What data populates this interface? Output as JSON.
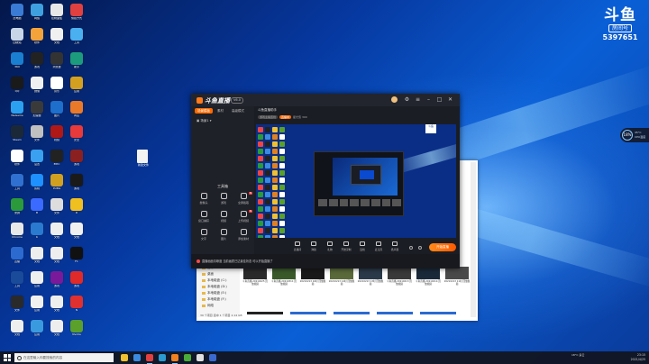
{
  "watermark": {
    "logo": "斗鱼",
    "sub": "房间号",
    "room_number": "5397651"
  },
  "cpu_widget": {
    "value": "18%",
    "line1": "45°C",
    "line2": "CPU温度"
  },
  "desktop": {
    "icons": [
      {
        "label": "此电脑",
        "color": "#3a7bd5"
      },
      {
        "label": "网络",
        "color": "#3fa0e0"
      },
      {
        "label": "控制面板",
        "color": "#e7e7e7"
      },
      {
        "label": "快捷方式",
        "color": "#e04040"
      },
      {
        "label": "回收站",
        "color": "#c8d6e8"
      },
      {
        "label": "软件",
        "color": "#f3a33a"
      },
      {
        "label": "文档",
        "color": "#f0f0f0"
      },
      {
        "label": "工具",
        "color": "#4ab0f0"
      },
      {
        "label": "360",
        "color": "#1a7fd0"
      },
      {
        "label": "游戏",
        "color": "#222"
      },
      {
        "label": "浏览器",
        "color": "#333"
      },
      {
        "label": "助手",
        "color": "#1c9c7c"
      },
      {
        "label": "QQ",
        "color": "#1a1a1a"
      },
      {
        "label": "微信",
        "color": "#f0f0f0"
      },
      {
        "label": "音乐",
        "color": "#ffffff"
      },
      {
        "label": "应用",
        "color": "#d4a020"
      },
      {
        "label": "WeGame",
        "color": "#2ca0f0"
      },
      {
        "label": "加速器",
        "color": "#3a3a3a"
      },
      {
        "label": "图片",
        "color": "#1e6ecc"
      },
      {
        "label": "商店",
        "color": "#ea7a2a"
      },
      {
        "label": "Steam",
        "color": "#1b2838"
      },
      {
        "label": "文件",
        "color": "#c0c0c0"
      },
      {
        "label": "视频",
        "color": "#b01818"
      },
      {
        "label": "安全",
        "color": "#e83a3a"
      },
      {
        "label": "软件",
        "color": "#fff"
      },
      {
        "label": "设置",
        "color": "#3aa0f0"
      },
      {
        "label": "EPIC",
        "color": "#222"
      },
      {
        "label": "游戏",
        "color": "#8a2020"
      },
      {
        "label": "工具",
        "color": "#3070d0"
      },
      {
        "label": "剪辑",
        "color": "#1e90ff"
      },
      {
        "label": "PUBG",
        "color": "#d0a020"
      },
      {
        "label": "游戏",
        "color": "#1a1a1a"
      },
      {
        "label": "录屏",
        "color": "#2a9a3a"
      },
      {
        "label": "B",
        "color": "#3a6aff"
      },
      {
        "label": "文件",
        "color": "#ddd"
      },
      {
        "label": "D",
        "color": "#f0c020"
      },
      {
        "label": "Chrome",
        "color": "#e8e8e8"
      },
      {
        "label": "K",
        "color": "#2a7ad0"
      },
      {
        "label": "文档",
        "color": "#eee"
      },
      {
        "label": "文档",
        "color": "#f0f0f0"
      },
      {
        "label": "直播",
        "color": "#2c6ad0"
      },
      {
        "label": "文档",
        "color": "#eee"
      },
      {
        "label": "文档",
        "color": "#eee"
      },
      {
        "label": "F1",
        "color": "#111"
      },
      {
        "label": "工具",
        "color": "#1a4a9a"
      },
      {
        "label": "应用",
        "color": "#eee"
      },
      {
        "label": "游戏",
        "color": "#7a1a9a"
      },
      {
        "label": "游戏",
        "color": "#e02a2a"
      },
      {
        "label": "文件",
        "color": "#2a2a2a"
      },
      {
        "label": "应用",
        "color": "#f0f0f0"
      },
      {
        "label": "文档",
        "color": "#eee"
      },
      {
        "label": "N",
        "color": "#e03030"
      },
      {
        "label": "文档",
        "color": "#eee"
      },
      {
        "label": "应用",
        "color": "#3a9ae0"
      },
      {
        "label": "文档",
        "color": "#eee"
      },
      {
        "label": "Nvidia",
        "color": "#5aa02a"
      }
    ],
    "stray_file": "新建文件"
  },
  "stream_app": {
    "brand": "斗鱼直播",
    "version": "V6.0",
    "tabs": [
      "场景模板",
      "素材",
      "高级模式"
    ],
    "scene_label": "场景1",
    "tools_title": "工具箱",
    "tools": [
      {
        "label": "摄像头",
        "new": false
      },
      {
        "label": "游戏",
        "new": false
      },
      {
        "label": "全屏截取",
        "new": true
      },
      {
        "label": "窗口捕获",
        "new": false
      },
      {
        "label": "视频",
        "new": false
      },
      {
        "label": "上传视频",
        "new": true
      },
      {
        "label": "文字",
        "new": false
      },
      {
        "label": "图片",
        "new": false
      },
      {
        "label": "添加素材",
        "new": false
      }
    ],
    "header_title": "斗鱼直播助手",
    "pills": [
      "游戏主播连线",
      "直播中"
    ],
    "header_meta": "星光值 300",
    "preview_badge": "斗鱼",
    "controls": [
      "直播间",
      "弹幕",
      "礼物",
      "开始录制",
      "连线",
      "麦克风",
      "扬声器"
    ],
    "start_label": "开始直播",
    "notice": "直播画面清晰度 当前画质已达最佳状态 可以开始直播了"
  },
  "explorer": {
    "nav": [
      "音乐",
      "桌面",
      "本地磁盘 (C:)",
      "本地磁盘 (D:)",
      "本地磁盘 (E:)",
      "本地磁盘 (F:)",
      "网络"
    ],
    "thumbs": [
      {
        "caption": "斗鱼直播 20210225 回放视频"
      },
      {
        "caption": "斗鱼直播 20210311 回放视频"
      },
      {
        "caption": "20210213 16时 回放视频"
      },
      {
        "caption": "20210213 14时 回放视频"
      },
      {
        "caption": "20210213 13时 回放视频"
      },
      {
        "caption": "斗鱼直播 20210213 回放视频"
      },
      {
        "caption": "斗鱼直播 20210214 回放视频"
      },
      {
        "caption": "20210213 11时 回放视频"
      }
    ],
    "status": "39 个项目  选中 1 个项目 2.14 GB"
  },
  "taskbar": {
    "search_placeholder": "在这里输入你要搜索的内容",
    "weather": "18°C 多云",
    "time": "23:15",
    "date": "2021/4/25",
    "apps": [
      {
        "color": "#f0c030",
        "active": false
      },
      {
        "color": "#3a8ae0",
        "active": false
      },
      {
        "color": "#e04040",
        "active": true
      },
      {
        "color": "#2a9ad0",
        "active": false
      },
      {
        "color": "#f08020",
        "active": true
      },
      {
        "color": "#4aaa3a",
        "active": false
      },
      {
        "color": "#e0e0e0",
        "active": false
      },
      {
        "color": "#3a6ad0",
        "active": false
      }
    ]
  }
}
